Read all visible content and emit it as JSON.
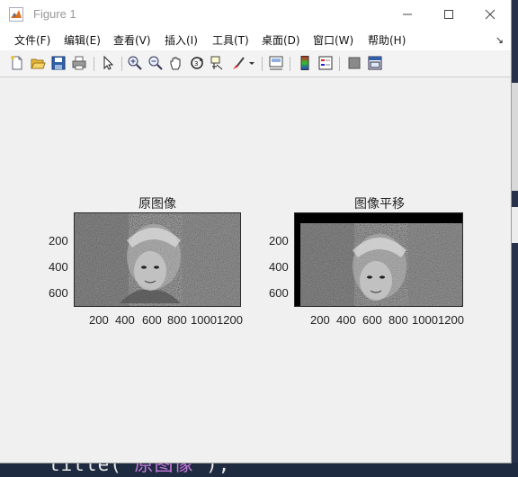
{
  "window": {
    "title": "Figure 1",
    "controls": [
      "minimize",
      "maximize",
      "close"
    ]
  },
  "menu": {
    "items": [
      "文件(F)",
      "编辑(E)",
      "查看(V)",
      "插入(I)",
      "工具(T)",
      "桌面(D)",
      "窗口(W)",
      "帮助(H)"
    ]
  },
  "toolbar": {
    "icons": [
      "new-figure-icon",
      "open-file-icon",
      "save-icon",
      "print-icon",
      "pointer-icon",
      "zoom-in-icon",
      "zoom-out-icon",
      "pan-hand-icon",
      "rotate-3d-icon",
      "data-cursor-icon",
      "brush-icon",
      "brush-dropdown-icon",
      "link-plot-icon",
      "colorbar-icon",
      "legend-icon",
      "hide-plot-tools-icon",
      "show-plot-tools-icon"
    ]
  },
  "plots": [
    {
      "title": "原图像",
      "xticks": [
        "200",
        "400",
        "600",
        "800",
        "1000",
        "1200"
      ],
      "yticks": [
        "200",
        "400",
        "600"
      ]
    },
    {
      "title": "图像平移",
      "xticks": [
        "200",
        "400",
        "600",
        "800",
        "1000",
        "1200"
      ],
      "yticks": [
        "200",
        "400",
        "600"
      ]
    }
  ],
  "background": {
    "code_prefix": "title('",
    "code_string": "原图像",
    "code_suffix": "');"
  },
  "colors": {
    "titlebar": "#ffffff",
    "figure_bg": "#f0f0f0",
    "editor_bg": "#1e2a3f"
  }
}
